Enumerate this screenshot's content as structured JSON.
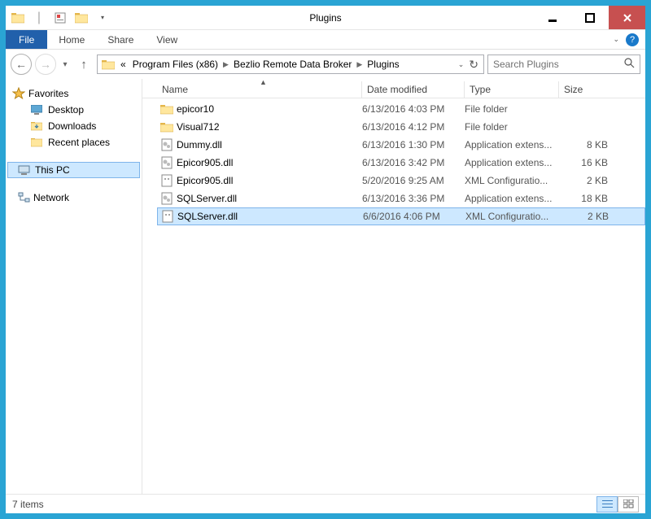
{
  "title": "Plugins",
  "ribbon": {
    "file": "File",
    "tabs": [
      "Home",
      "Share",
      "View"
    ]
  },
  "breadcrumb": {
    "prefix": "«",
    "parts": [
      "Program Files (x86)",
      "Bezlio Remote Data Broker",
      "Plugins"
    ]
  },
  "search": {
    "placeholder": "Search Plugins"
  },
  "nav": {
    "favorites": {
      "label": "Favorites",
      "items": [
        "Desktop",
        "Downloads",
        "Recent places"
      ]
    },
    "thispc": {
      "label": "This PC"
    },
    "network": {
      "label": "Network"
    }
  },
  "columns": {
    "name": "Name",
    "date": "Date modified",
    "type": "Type",
    "size": "Size"
  },
  "files": [
    {
      "icon": "folder",
      "name": "epicor10",
      "date": "6/13/2016 4:03 PM",
      "type": "File folder",
      "size": "",
      "selected": false
    },
    {
      "icon": "folder",
      "name": "Visual712",
      "date": "6/13/2016 4:12 PM",
      "type": "File folder",
      "size": "",
      "selected": false
    },
    {
      "icon": "dll",
      "name": "Dummy.dll",
      "date": "6/13/2016 1:30 PM",
      "type": "Application extens...",
      "size": "8 KB",
      "selected": false
    },
    {
      "icon": "dll",
      "name": "Epicor905.dll",
      "date": "6/13/2016 3:42 PM",
      "type": "Application extens...",
      "size": "16 KB",
      "selected": false
    },
    {
      "icon": "xml",
      "name": "Epicor905.dll",
      "date": "5/20/2016 9:25 AM",
      "type": "XML Configuratio...",
      "size": "2 KB",
      "selected": false
    },
    {
      "icon": "dll",
      "name": "SQLServer.dll",
      "date": "6/13/2016 3:36 PM",
      "type": "Application extens...",
      "size": "18 KB",
      "selected": false
    },
    {
      "icon": "xml",
      "name": "SQLServer.dll",
      "date": "6/6/2016 4:06 PM",
      "type": "XML Configuratio...",
      "size": "2 KB",
      "selected": true
    }
  ],
  "status": {
    "count": "7 items"
  }
}
